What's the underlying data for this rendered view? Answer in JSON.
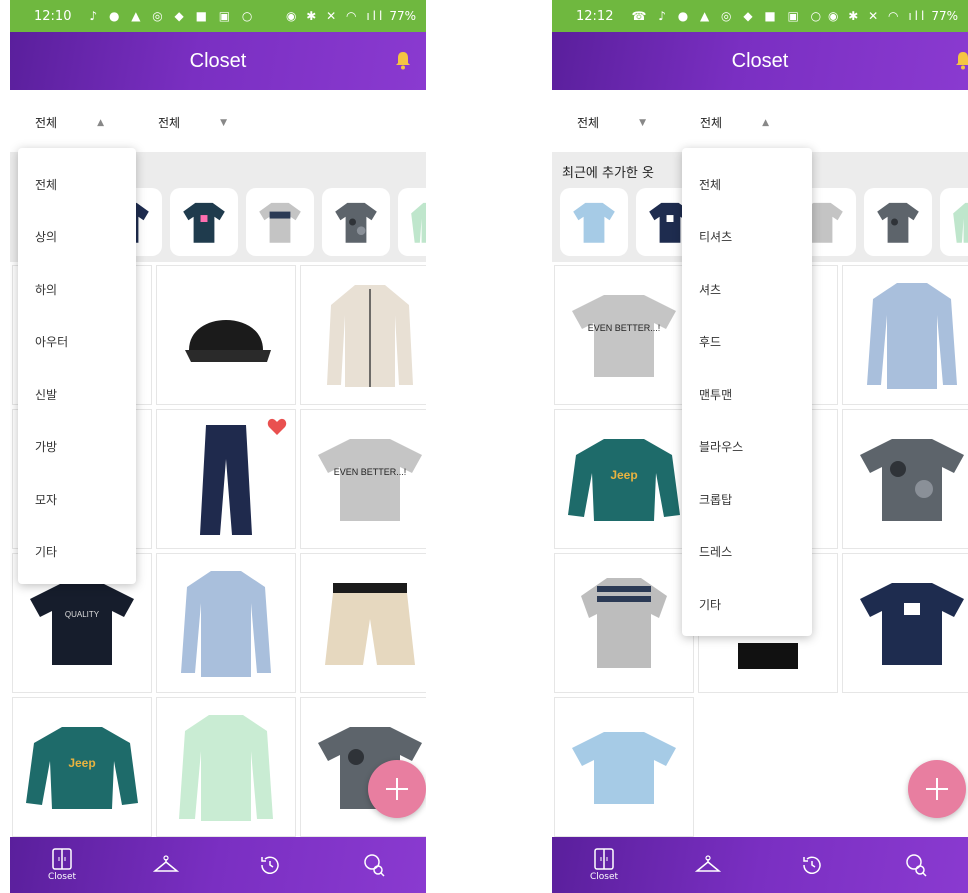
{
  "colors": {
    "appbar": "#7a2fc2",
    "statusbar": "#6fb83f",
    "fab": "#e87ea0",
    "heart": "#e9504f",
    "bell": "#f5c542",
    "band": "#ececec"
  },
  "screens": [
    {
      "status": {
        "time": "12:10",
        "battery": "77%"
      },
      "appbar": {
        "title": "Closet",
        "icon": "bell-icon"
      },
      "filters": [
        {
          "label": "전체",
          "arrow": "▲"
        },
        {
          "label": "전체",
          "arrow": "▼"
        }
      ],
      "recent": {
        "title": ""
      },
      "dropdown": {
        "options": [
          "전체",
          "상의",
          "하의",
          "아우터",
          "신발",
          "가방",
          "모자",
          "기타"
        ]
      },
      "nav": {
        "items": [
          {
            "icon": "closet-icon",
            "label": "Closet"
          },
          {
            "icon": "hanger-icon",
            "label": ""
          },
          {
            "icon": "history-icon",
            "label": ""
          },
          {
            "icon": "user-search-icon",
            "label": ""
          }
        ]
      }
    },
    {
      "status": {
        "time": "12:12",
        "battery": "77%"
      },
      "appbar": {
        "title": "Closet",
        "icon": "bell-icon"
      },
      "filters": [
        {
          "label": "전체",
          "arrow": "▼"
        },
        {
          "label": "전체",
          "arrow": "▲"
        }
      ],
      "recent": {
        "title": "최근에 추가한 옷"
      },
      "dropdown": {
        "options": [
          "전체",
          "티셔츠",
          "셔츠",
          "후드",
          "맨투맨",
          "블라우스",
          "크롭탑",
          "드레스",
          "기타"
        ]
      },
      "nav": {
        "items": [
          {
            "icon": "closet-icon",
            "label": "Closet"
          },
          {
            "icon": "hanger-icon",
            "label": ""
          },
          {
            "icon": "history-icon",
            "label": ""
          },
          {
            "icon": "user-search-icon",
            "label": ""
          }
        ]
      }
    }
  ]
}
